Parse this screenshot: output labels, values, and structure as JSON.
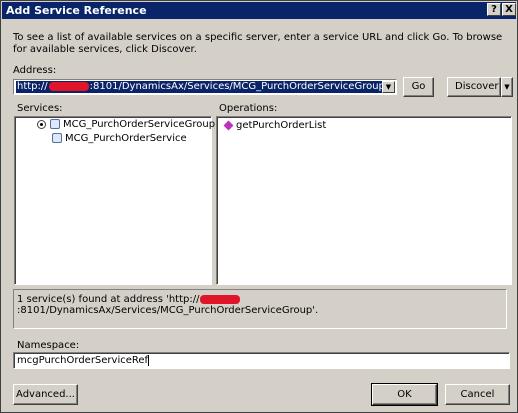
{
  "window": {
    "title": "Add Service Reference",
    "help_glyph": "?",
    "close_glyph": "X"
  },
  "intro": "To see a list of available services on a specific server, enter a service URL and click Go. To browse for available services, click Discover.",
  "address": {
    "label": "Address:",
    "value_prefix": "http://",
    "value_suffix": ":8101/DynamicsAx/Services/MCG_PurchOrderServiceGroup"
  },
  "buttons": {
    "go": "Go",
    "discover": "Discover",
    "advanced": "Advanced...",
    "ok": "OK",
    "cancel": "Cancel"
  },
  "services": {
    "label": "Services:",
    "items": [
      "MCG_PurchOrderServiceGroup",
      "MCG_PurchOrderService"
    ]
  },
  "operations": {
    "label": "Operations:",
    "items": [
      "getPurchOrderList"
    ]
  },
  "status": {
    "prefix": "1 service(s) found at address 'http://",
    "suffix": ":8101/DynamicsAx/Services/MCG_PurchOrderServiceGroup'."
  },
  "namespace": {
    "label": "Namespace:",
    "value": "mcgPurchOrderServiceRef"
  },
  "colors": {
    "titlebar": "#0a246a",
    "face": "#d4d0c8",
    "redaction": "#e0152a"
  }
}
